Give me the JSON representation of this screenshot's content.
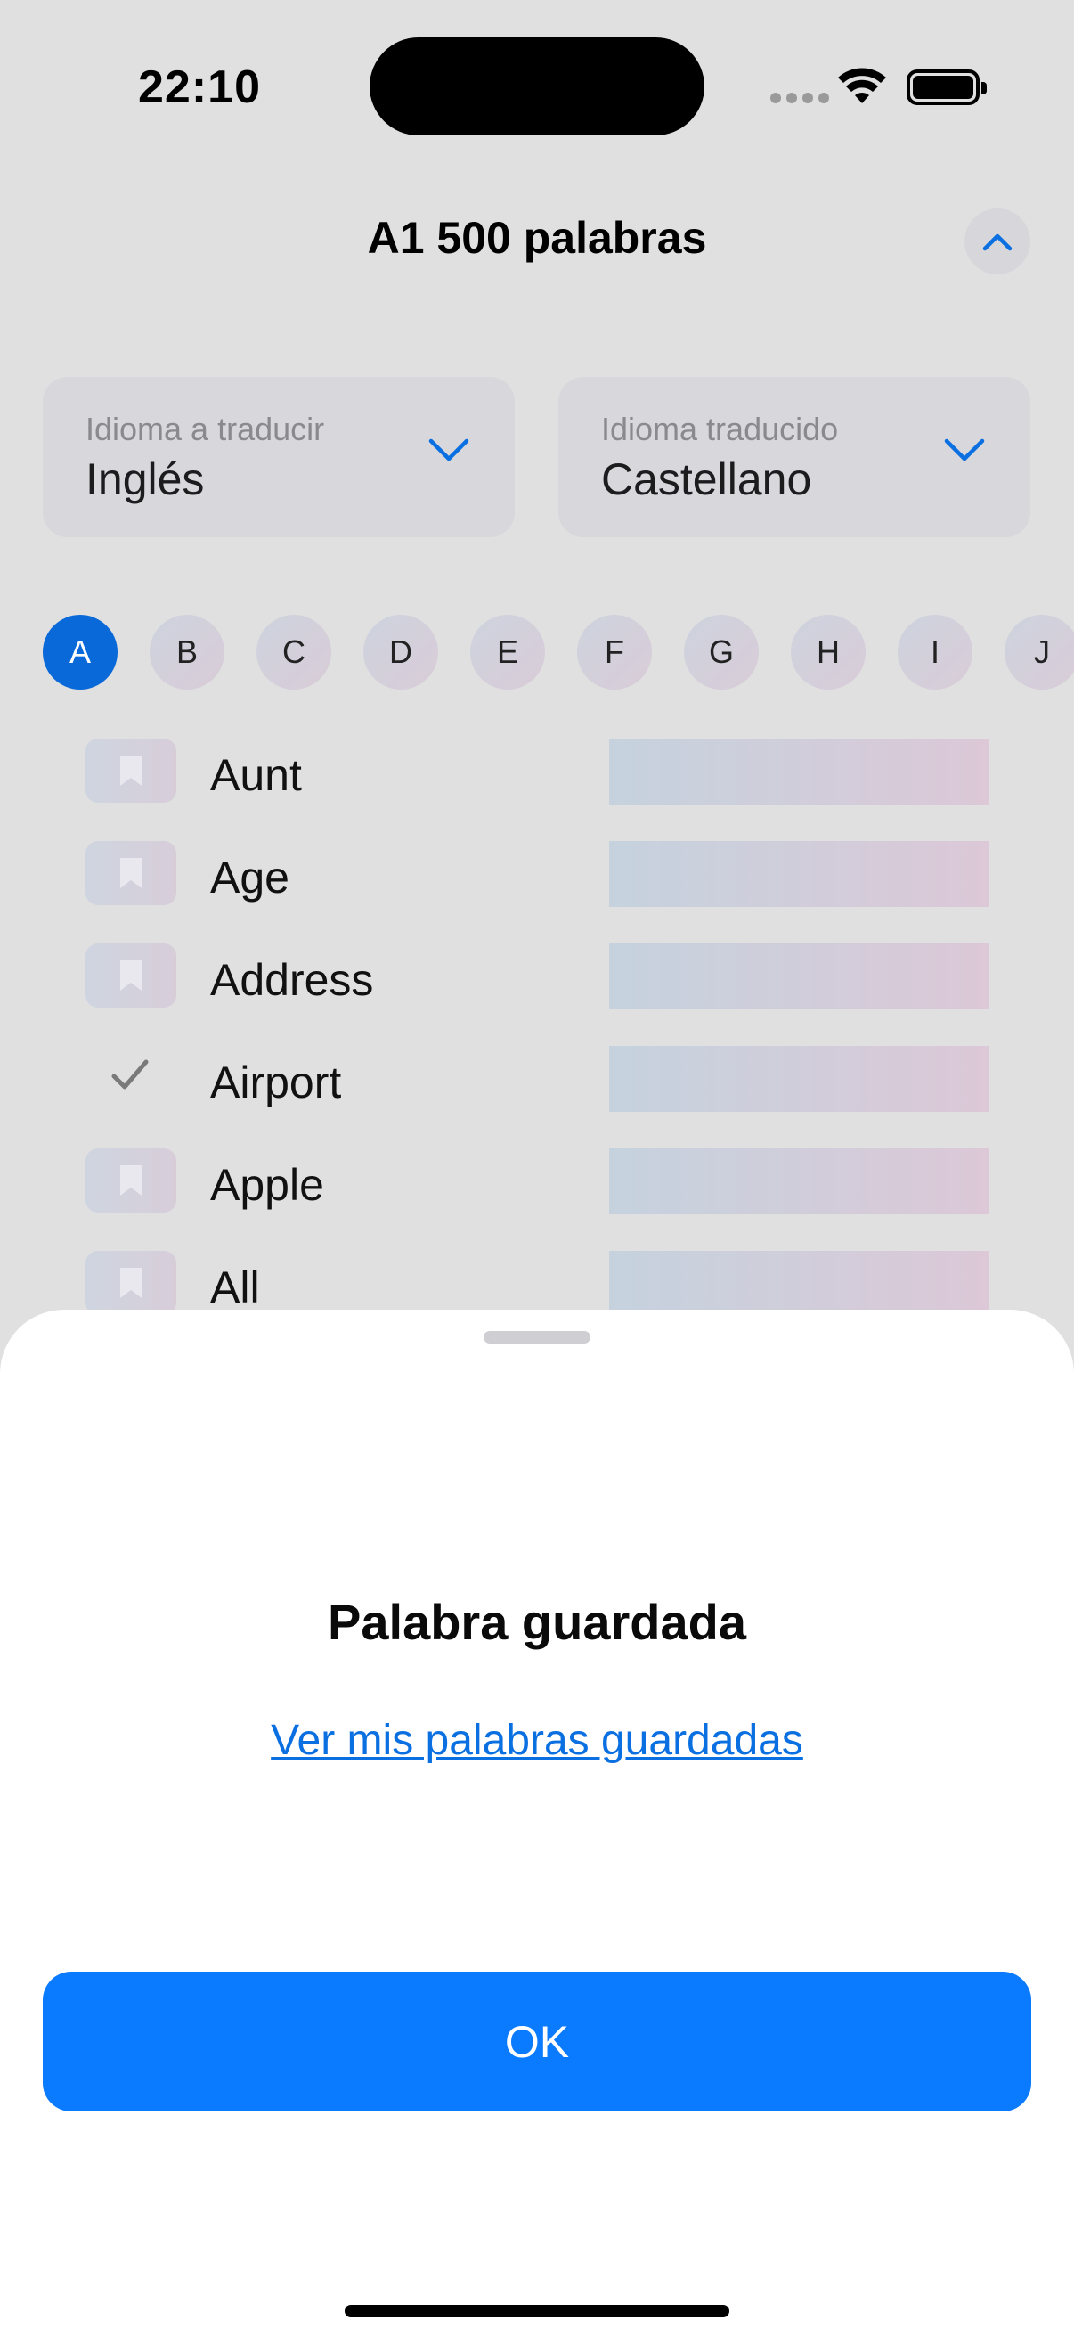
{
  "status": {
    "time": "22:10"
  },
  "header": {
    "title": "A1 500 palabras"
  },
  "languages": {
    "from": {
      "label": "Idioma a traducir",
      "value": "Inglés"
    },
    "to": {
      "label": "Idioma traducido",
      "value": "Castellano"
    }
  },
  "letters": [
    "A",
    "B",
    "C",
    "D",
    "E",
    "F",
    "G",
    "H",
    "I",
    "J"
  ],
  "active_letter": "A",
  "words": [
    {
      "text": "Aunt",
      "state": "bookmark"
    },
    {
      "text": "Age",
      "state": "bookmark"
    },
    {
      "text": "Address",
      "state": "bookmark"
    },
    {
      "text": "Airport",
      "state": "saved"
    },
    {
      "text": "Apple",
      "state": "bookmark"
    },
    {
      "text": "All",
      "state": "bookmark"
    }
  ],
  "sheet": {
    "title": "Palabra guardada",
    "link": "Ver mis palabras guardadas",
    "ok_label": "OK"
  },
  "colors": {
    "accent": "#0a7aff",
    "link": "#0a6fe0",
    "active_letter": "#0a69d9"
  }
}
